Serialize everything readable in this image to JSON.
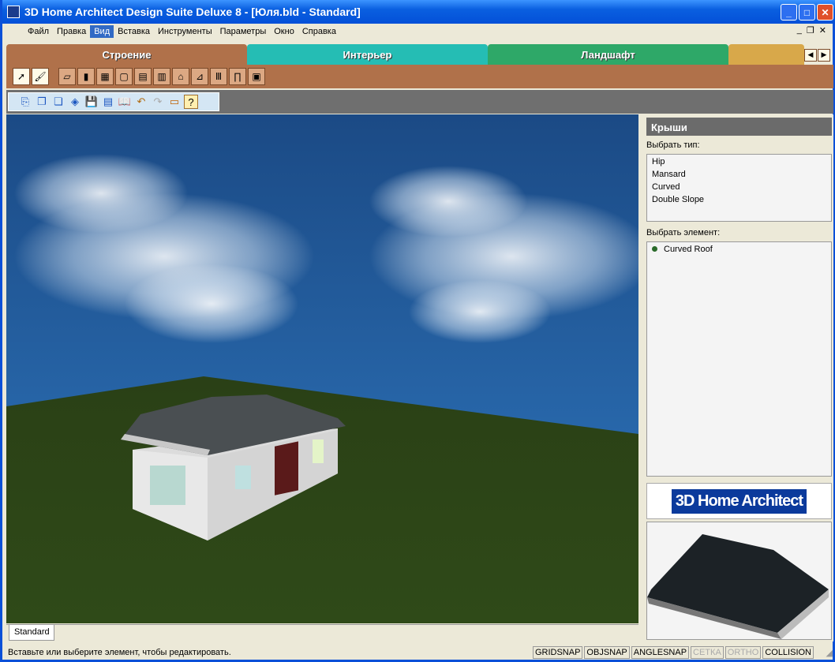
{
  "window": {
    "title": "3D Home Architect Design Suite Deluxe 8 - [Юля.bld - Standard]"
  },
  "menu": [
    "Файл",
    "Правка",
    "Вид",
    "Вставка",
    "Инструменты",
    "Параметры",
    "Окно",
    "Справка"
  ],
  "tabs": [
    {
      "label": "Строение",
      "color": "#b0714a"
    },
    {
      "label": "Интерьер",
      "color": "#25bdb4"
    },
    {
      "label": "Ландшафт",
      "color": "#2ea868"
    },
    {
      "label": "",
      "color": "#d8a84a"
    }
  ],
  "panel": {
    "title": "Крыши",
    "type_label": "Выбрать тип:",
    "types": [
      "Hip",
      "Mansard",
      "Curved",
      "Double Slope"
    ],
    "element_label": "Выбрать элемент:",
    "elements": [
      "Curved Roof"
    ],
    "logo": "3D Home Architect"
  },
  "view_tab": "Standard",
  "status": {
    "message": "Вставьте или выберите элемент, чтобы редактировать.",
    "indicators": [
      {
        "label": "GRIDSNAP",
        "enabled": true
      },
      {
        "label": "OBJSNAP",
        "enabled": true
      },
      {
        "label": "ANGLESNAP",
        "enabled": true
      },
      {
        "label": "СЕТКА",
        "enabled": false
      },
      {
        "label": "ORTHO",
        "enabled": false
      },
      {
        "label": "COLLISION",
        "enabled": true
      }
    ]
  }
}
